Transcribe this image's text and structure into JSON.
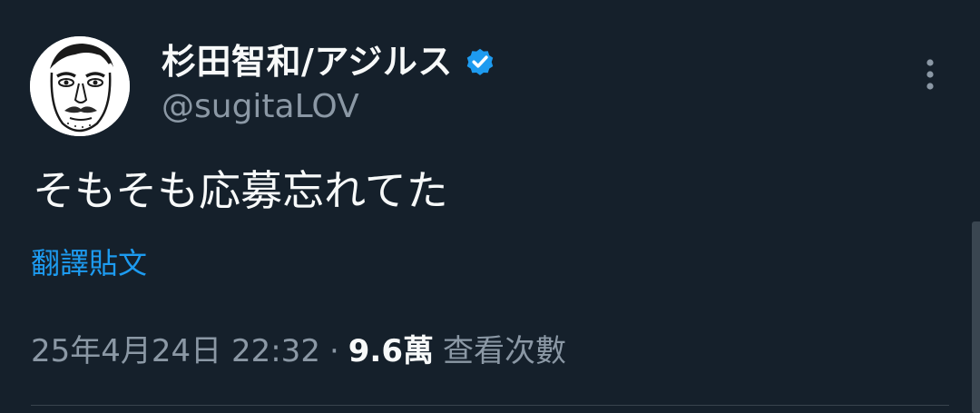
{
  "tweet": {
    "author": {
      "display_name": "杉田智和/アジルス",
      "handle": "@sugitaLOV",
      "verified": true,
      "avatar_icon": "caricature-face-avatar"
    },
    "text": "そもそも応募忘れてた",
    "translate_label": "翻譯貼文",
    "meta": {
      "timestamp": "25年4月24日 22:32",
      "separator": "·",
      "views_count": "9.6萬",
      "views_label": "查看次數"
    },
    "more_icon": "more-vertical-icon"
  },
  "colors": {
    "background": "#15202b",
    "primary_text": "#f7f9f9",
    "secondary_text": "#8b98a5",
    "accent": "#1d9bf0",
    "divider": "#38444d"
  }
}
